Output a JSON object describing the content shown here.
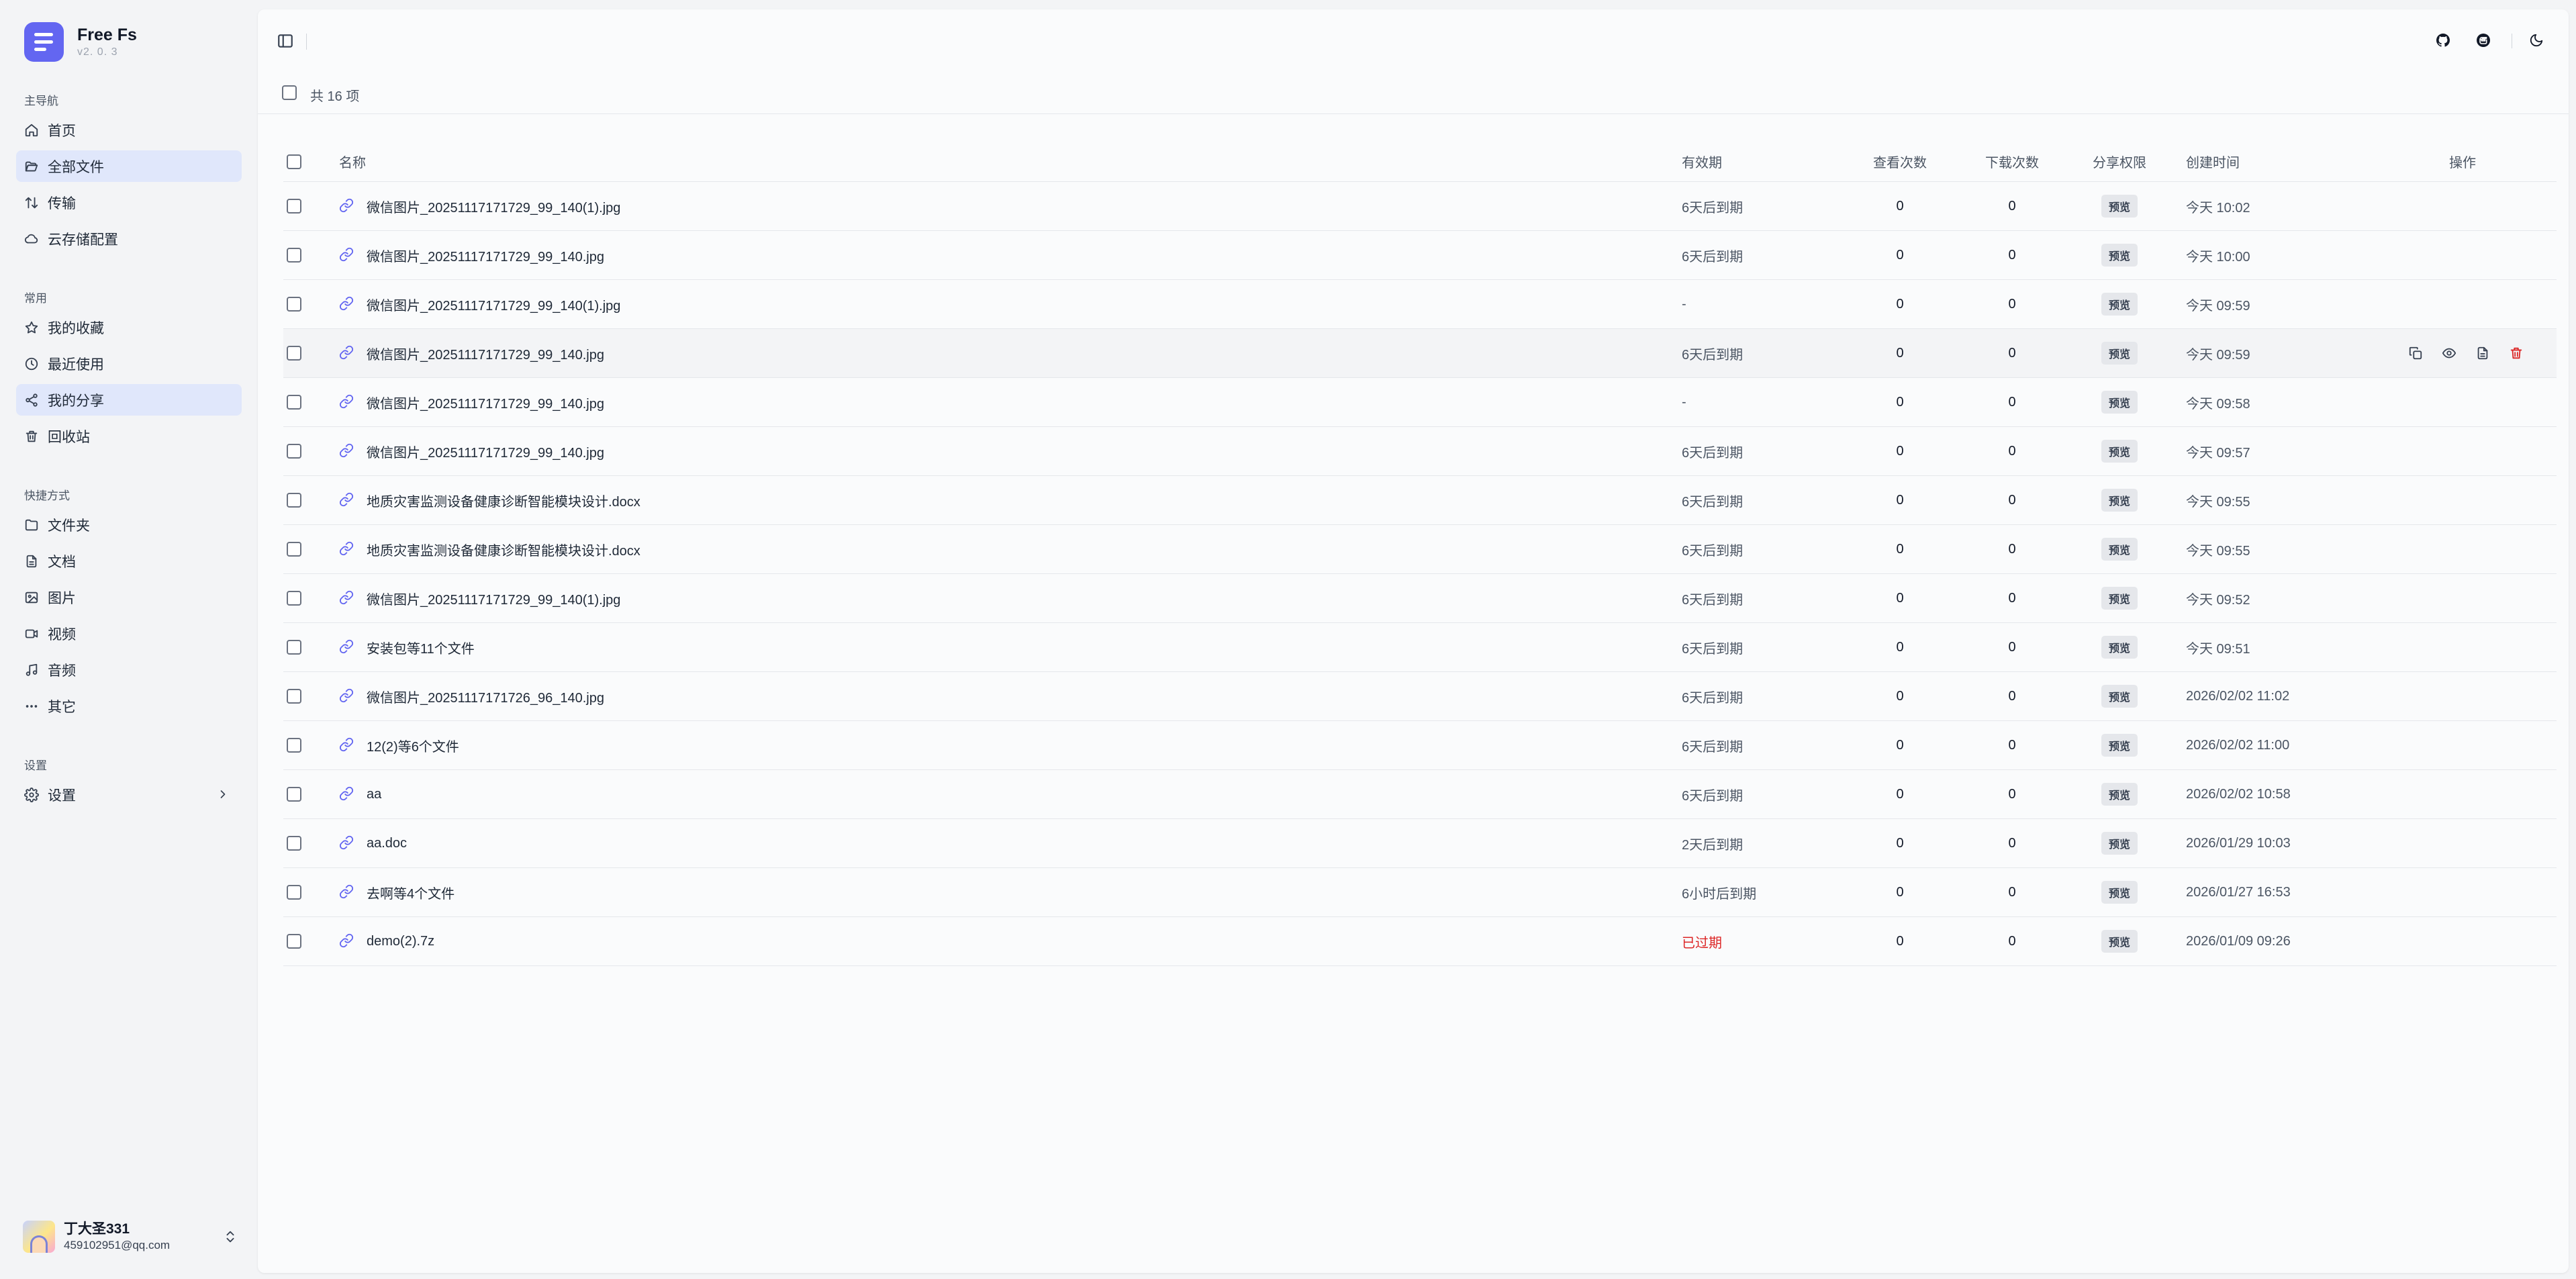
{
  "brand": {
    "name": "Free Fs",
    "version": "v2. 0. 3"
  },
  "nav": {
    "main_title": "主导航",
    "main_items": [
      {
        "label": "首页",
        "icon": "home-icon"
      },
      {
        "label": "全部文件",
        "icon": "folder-open-icon"
      },
      {
        "label": "传输",
        "icon": "transfer-icon"
      },
      {
        "label": "云存储配置",
        "icon": "cloud-icon"
      }
    ],
    "common_title": "常用",
    "common_items": [
      {
        "label": "我的收藏",
        "icon": "star-icon"
      },
      {
        "label": "最近使用",
        "icon": "clock-icon"
      },
      {
        "label": "我的分享",
        "icon": "share-icon"
      },
      {
        "label": "回收站",
        "icon": "trash-icon"
      }
    ],
    "shortcut_title": "快捷方式",
    "shortcut_items": [
      {
        "label": "文件夹",
        "icon": "folder-icon"
      },
      {
        "label": "文档",
        "icon": "document-icon"
      },
      {
        "label": "图片",
        "icon": "image-icon"
      },
      {
        "label": "视频",
        "icon": "video-icon"
      },
      {
        "label": "音频",
        "icon": "music-icon"
      },
      {
        "label": "其它",
        "icon": "more-icon"
      }
    ],
    "settings_title": "设置",
    "settings_items": [
      {
        "label": "设置",
        "icon": "gear-icon"
      }
    ]
  },
  "user": {
    "name": "丁大圣331",
    "email": "459102951@qq.com"
  },
  "toolbar": {
    "count": "共 16 项"
  },
  "table": {
    "headers": {
      "name": "名称",
      "expiry": "有效期",
      "views": "查看次数",
      "downloads": "下载次数",
      "permission": "分享权限",
      "created": "创建时间",
      "actions": "操作"
    },
    "rows": [
      {
        "name": "微信图片_20251117171729_99_140(1).jpg",
        "expiry": "6天后到期",
        "views": "0",
        "downloads": "0",
        "permission": "预览",
        "created": "今天 10:02"
      },
      {
        "name": "微信图片_20251117171729_99_140.jpg",
        "expiry": "6天后到期",
        "views": "0",
        "downloads": "0",
        "permission": "预览",
        "created": "今天 10:00"
      },
      {
        "name": "微信图片_20251117171729_99_140(1).jpg",
        "expiry": "-",
        "views": "0",
        "downloads": "0",
        "permission": "预览",
        "created": "今天 09:59"
      },
      {
        "name": "微信图片_20251117171729_99_140.jpg",
        "expiry": "6天后到期",
        "views": "0",
        "downloads": "0",
        "permission": "预览",
        "created": "今天 09:59"
      },
      {
        "name": "微信图片_20251117171729_99_140.jpg",
        "expiry": "-",
        "views": "0",
        "downloads": "0",
        "permission": "预览",
        "created": "今天 09:58"
      },
      {
        "name": "微信图片_20251117171729_99_140.jpg",
        "expiry": "6天后到期",
        "views": "0",
        "downloads": "0",
        "permission": "预览",
        "created": "今天 09:57"
      },
      {
        "name": "地质灾害监测设备健康诊断智能模块设计.docx",
        "expiry": "6天后到期",
        "views": "0",
        "downloads": "0",
        "permission": "预览",
        "created": "今天 09:55"
      },
      {
        "name": "地质灾害监测设备健康诊断智能模块设计.docx",
        "expiry": "6天后到期",
        "views": "0",
        "downloads": "0",
        "permission": "预览",
        "created": "今天 09:55"
      },
      {
        "name": "微信图片_20251117171729_99_140(1).jpg",
        "expiry": "6天后到期",
        "views": "0",
        "downloads": "0",
        "permission": "预览",
        "created": "今天 09:52"
      },
      {
        "name": "安装包等11个文件",
        "expiry": "6天后到期",
        "views": "0",
        "downloads": "0",
        "permission": "预览",
        "created": "今天 09:51"
      },
      {
        "name": "微信图片_20251117171726_96_140.jpg",
        "expiry": "6天后到期",
        "views": "0",
        "downloads": "0",
        "permission": "预览",
        "created": "2026/02/02 11:02"
      },
      {
        "name": "12(2)等6个文件",
        "expiry": "6天后到期",
        "views": "0",
        "downloads": "0",
        "permission": "预览",
        "created": "2026/02/02 11:00"
      },
      {
        "name": "aa",
        "expiry": "6天后到期",
        "views": "0",
        "downloads": "0",
        "permission": "预览",
        "created": "2026/02/02 10:58"
      },
      {
        "name": "aa.doc",
        "expiry": "2天后到期",
        "views": "0",
        "downloads": "0",
        "permission": "预览",
        "created": "2026/01/29 10:03"
      },
      {
        "name": "去啊等4个文件",
        "expiry": "6小时后到期",
        "views": "0",
        "downloads": "0",
        "permission": "预览",
        "created": "2026/01/27 16:53"
      },
      {
        "name": "demo(2).7z",
        "expiry": "已过期",
        "views": "0",
        "downloads": "0",
        "permission": "预览",
        "created": "2026/01/09 09:26"
      }
    ]
  },
  "colors": {
    "accent": "#6366f1",
    "active_bg": "#e0e7fb",
    "expired": "#dc2626"
  }
}
